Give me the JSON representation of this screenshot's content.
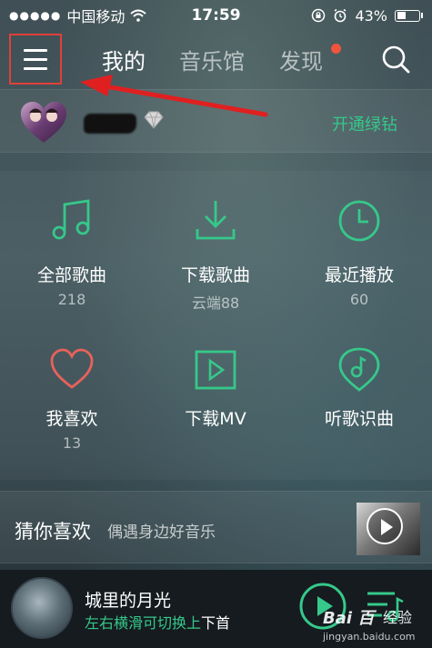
{
  "status_bar": {
    "signal_dots": "●●●●●",
    "carrier": "中国移动",
    "time": "17:59",
    "battery_percent": "43%",
    "battery_level": 0.43
  },
  "nav": {
    "tabs": [
      {
        "label": "我的",
        "active": true
      },
      {
        "label": "音乐馆",
        "active": false
      },
      {
        "label": "发现",
        "active": false,
        "badge": true
      }
    ],
    "search_icon": "search-icon",
    "menu_icon": "hamburger-icon"
  },
  "user": {
    "avatar_icon": "heart-avatar",
    "vip_icon": "diamond-icon",
    "vip_label": "开通绿钻"
  },
  "grid": [
    {
      "icon": "music-note-icon",
      "label": "全部歌曲",
      "count": "218"
    },
    {
      "icon": "download-icon",
      "label": "下载歌曲",
      "count": "云端88"
    },
    {
      "icon": "clock-icon",
      "label": "最近播放",
      "count": "60"
    },
    {
      "icon": "heart-icon",
      "label": "我喜欢",
      "count": "13"
    },
    {
      "icon": "play-box-icon",
      "label": "下载MV",
      "count": ""
    },
    {
      "icon": "recognize-icon",
      "label": "听歌识曲",
      "count": ""
    }
  ],
  "recommend": {
    "title": "猜你喜欢",
    "subtitle": "偶遇身边好音乐"
  },
  "player": {
    "song_title": "城里的月光",
    "hint_green": "左右横滑可切换上",
    "hint_white": "下首"
  },
  "watermark": {
    "brand": "Bai 百",
    "suffix": "经验",
    "url": "jingyan.baidu.com"
  },
  "colors": {
    "accent_green": "#36c88a",
    "highlight_red": "#e0403a",
    "heart_red": "#e8625a",
    "badge_red": "#f0543c"
  }
}
